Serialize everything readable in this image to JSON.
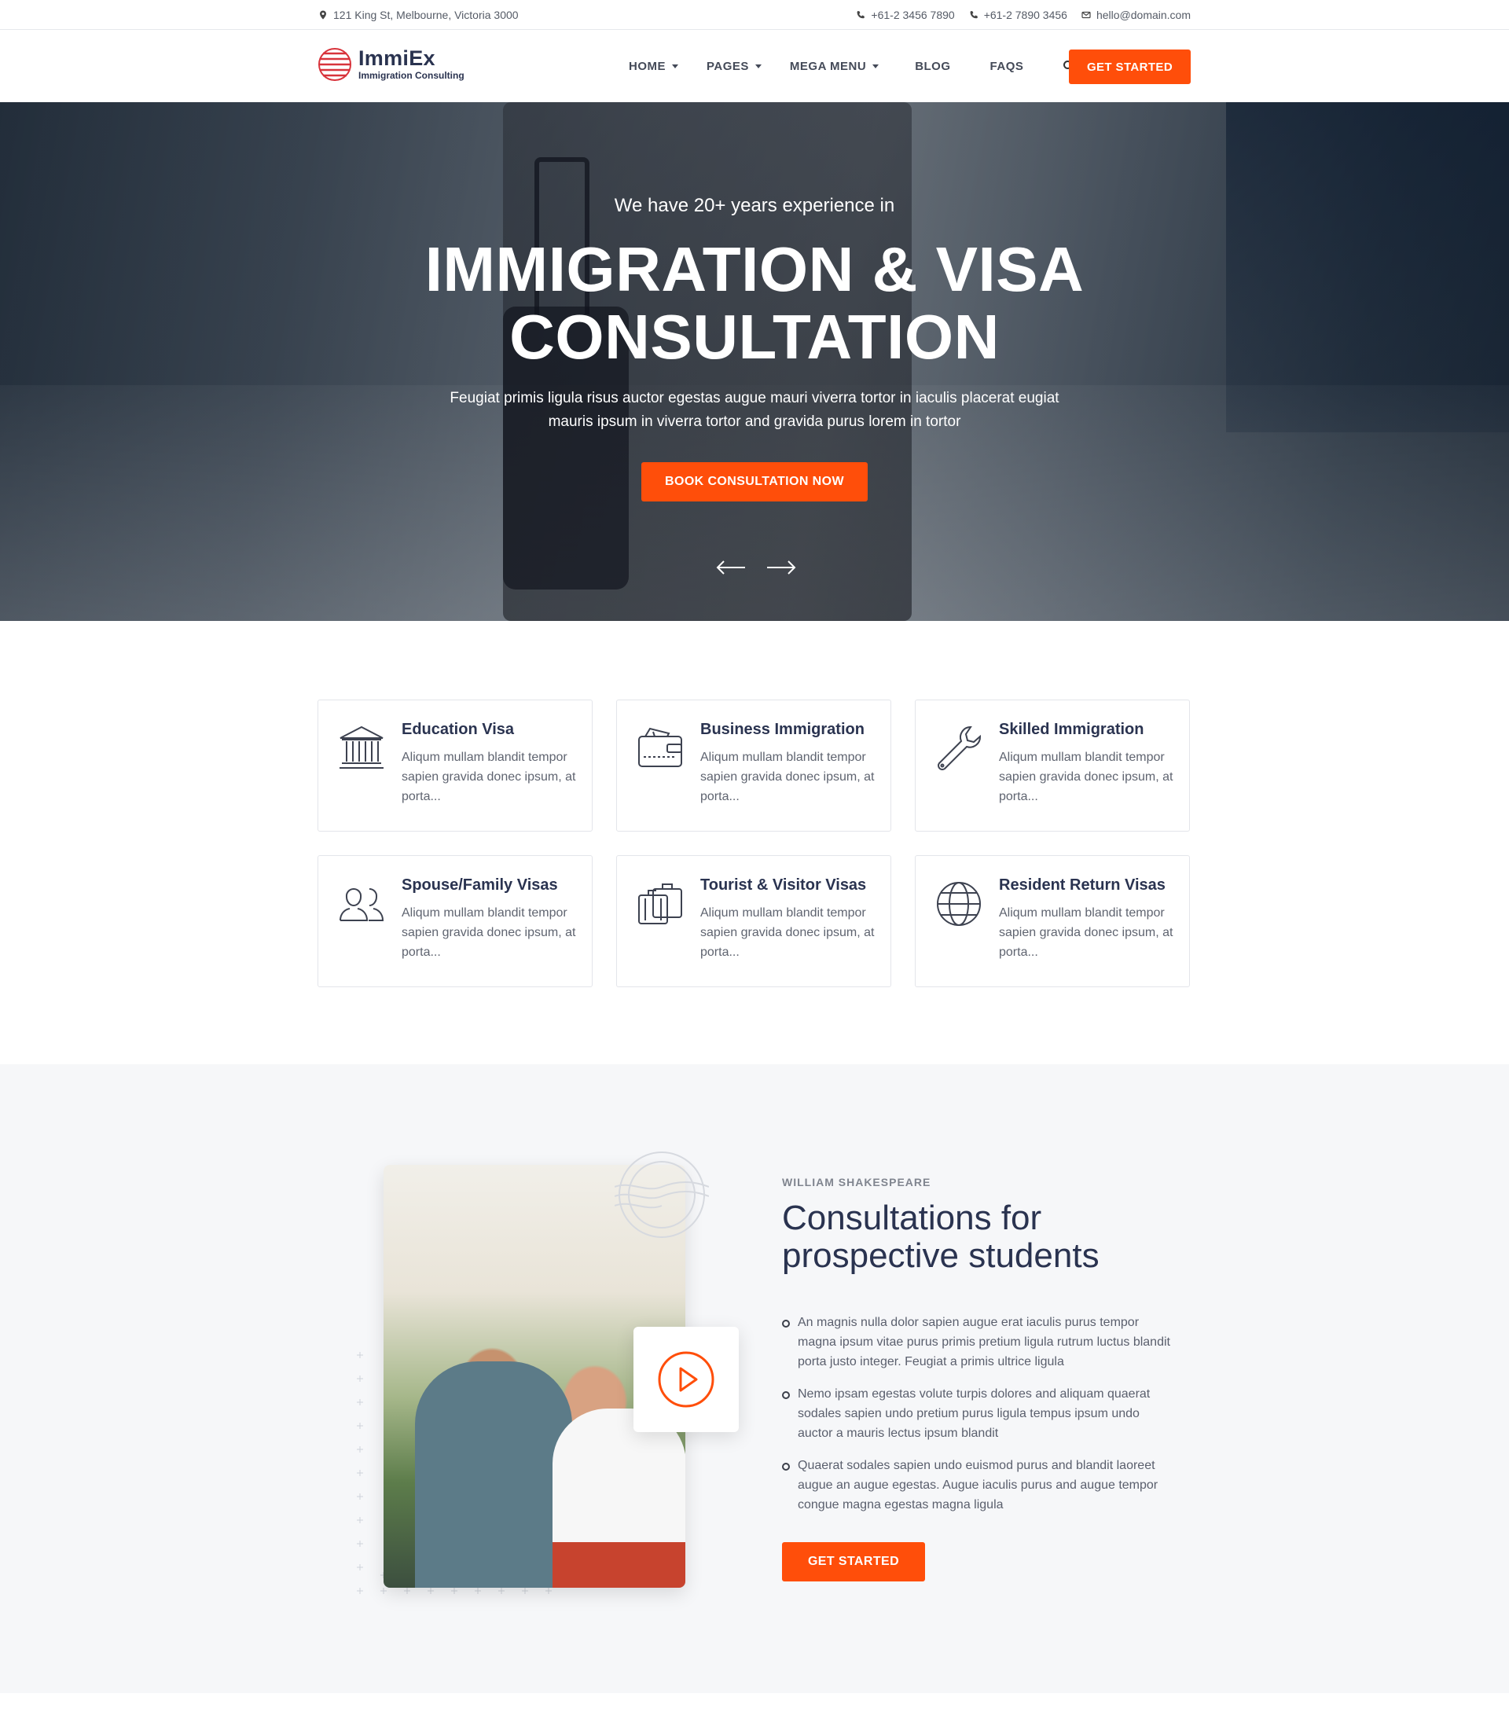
{
  "topbar": {
    "address": "121 King St, Melbourne, Victoria 3000",
    "phone1": "+61-2 3456 7890",
    "phone2": "+61-2 7890 3456",
    "email": "hello@domain.com",
    "icons": [
      "map-pin-icon",
      "phone-icon",
      "phone-icon",
      "envelope-icon"
    ]
  },
  "header": {
    "logo_name": "ImmiEx",
    "logo_tagline": "Immigration Consulting",
    "nav": [
      {
        "label": "HOME",
        "dropdown": true
      },
      {
        "label": "PAGES",
        "dropdown": true
      },
      {
        "label": "MEGA MENU",
        "dropdown": true
      },
      {
        "label": "BLOG",
        "dropdown": false
      },
      {
        "label": "FAQS",
        "dropdown": false
      }
    ],
    "cta_label": "GET STARTED",
    "accent_color": "#ff4e0a"
  },
  "hero": {
    "subtitle": "We have 20+ years experience in",
    "title_line1": "IMMIGRATION & VISA",
    "title_line2": "CONSULTATION",
    "description": "Feugiat primis ligula risus auctor egestas augue mauri viverra tortor in iaculis placerat eugiat mauris ipsum in viverra tortor and gravida purus lorem in tortor",
    "cta_label": "BOOK CONSULTATION NOW"
  },
  "services": [
    {
      "title": "Education Visa",
      "text": "Aliqum mullam blandit tempor sapien gravida donec ipsum, at porta...",
      "icon": "bank-icon"
    },
    {
      "title": "Business Immigration",
      "text": "Aliqum mullam blandit tempor sapien gravida donec ipsum, at porta...",
      "icon": "wallet-icon"
    },
    {
      "title": "Skilled Immigration",
      "text": "Aliqum mullam blandit tempor sapien gravida donec ipsum, at porta...",
      "icon": "wrench-icon"
    },
    {
      "title": "Spouse/Family Visas",
      "text": "Aliqum mullam blandit tempor sapien gravida donec ipsum, at porta...",
      "icon": "users-icon"
    },
    {
      "title": "Tourist & Visitor Visas",
      "text": "Aliqum mullam blandit tempor sapien gravida donec ipsum, at porta...",
      "icon": "luggage-icon"
    },
    {
      "title": "Resident Return Visas",
      "text": "Aliqum mullam blandit tempor sapien gravida donec ipsum, at porta...",
      "icon": "globe-icon"
    }
  ],
  "consult": {
    "eyebrow": "WILLIAM SHAKESPEARE",
    "title": "Consultations for prospective students",
    "bullets": [
      "An magnis nulla dolor sapien augue erat iaculis purus tempor magna ipsum vitae purus primis pretium ligula rutrum luctus blandit porta justo integer. Feugiat a primis ultrice ligula",
      "Nemo ipsam egestas volute turpis dolores and aliquam quaerat sodales sapien undo pretium purus ligula tempus ipsum undo auctor a mauris lectus ipsum blandit",
      "Quaerat sodales sapien undo euismod purus and blandit laoreet augue an augue egestas. Augue iaculis purus and augue tempor congue magna egestas magna ligula"
    ],
    "cta_label": "GET STARTED"
  }
}
